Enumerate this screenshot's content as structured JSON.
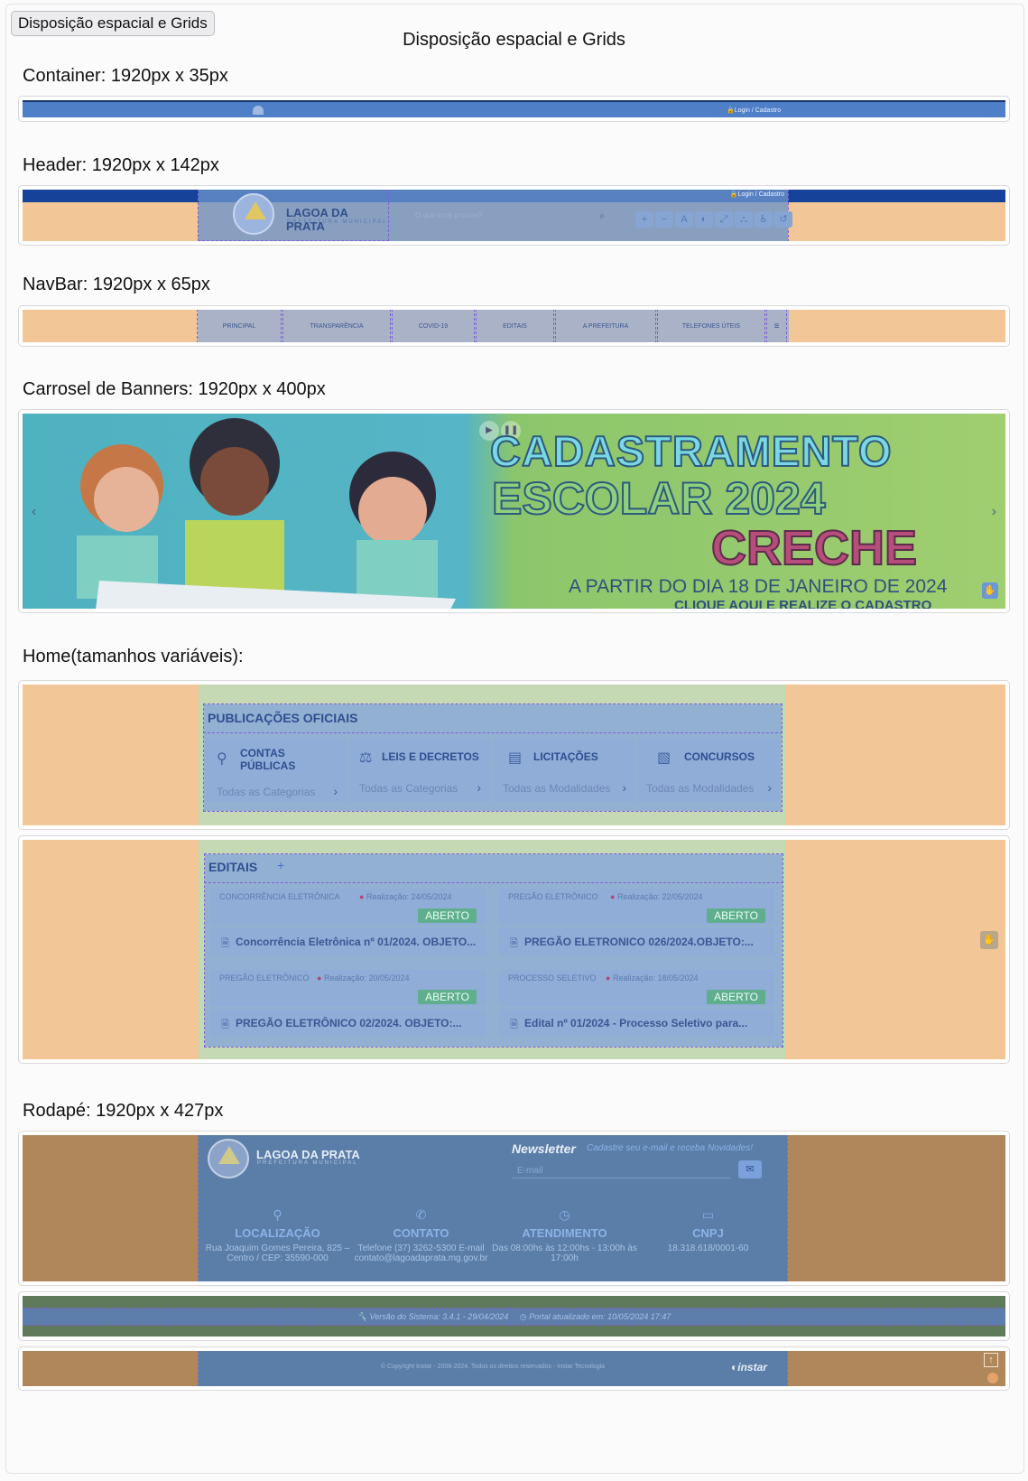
{
  "top_button": "Disposição espacial e Grids",
  "page_title": "Disposição espacial e Grids",
  "sections": {
    "container": "Container: 1920px x 35px",
    "header": "Header: 1920px x 142px",
    "navbar": "NavBar: 1920px x 65px",
    "carousel": "Carrosel de Banners: 1920px x 400px",
    "home": "Home(tamanhos variáveis):",
    "footer": "Rodapé: 1920px x 427px"
  },
  "container_bar": {
    "login": "Login",
    "sep": "/",
    "cadastro": "Cadastro"
  },
  "header": {
    "brand": "LAGOA DA PRATA",
    "brand_sub": "PREFEITURA MUNICIPAL",
    "search_placeholder": "O que você procura?",
    "login": "Login",
    "sep": "/",
    "cadastro": "Cadastro",
    "tools": [
      "+",
      "−",
      "A",
      "◐",
      "⤢",
      "⛬",
      "♿",
      "↺"
    ]
  },
  "navbar": {
    "items": [
      "PRINCIPAL",
      "TRANSPARÊNCIA",
      "COVID-19",
      "EDITAIS",
      "A PREFEITURA",
      "TELEFONES ÚTEIS"
    ],
    "menu_icon": "≡"
  },
  "banner": {
    "line1": "CADASTRAMENTO",
    "line2": "ESCOLAR 2024",
    "line3": "CRECHE",
    "line4": "A PARTIR DO DIA 18 DE JANEIRO DE 2024",
    "line5": "CLIQUE AQUI E REALIZE O CADASTRO",
    "colors": {
      "teal": "#4fb2bf",
      "green": "#8cc66c",
      "magenta": "#b64d7a"
    }
  },
  "publicacoes": {
    "title": "PUBLICAÇÕES OFICIAIS",
    "cards": [
      {
        "title": "CONTAS PÚBLICAS",
        "link": "Todas as Categorias"
      },
      {
        "title": "LEIS E DECRETOS",
        "link": "Todas as Categorias"
      },
      {
        "title": "LICITAÇÕES",
        "link": "Todas as Modalidades"
      },
      {
        "title": "CONCURSOS",
        "link": "Todas as Modalidades"
      }
    ]
  },
  "editais": {
    "title": "EDITAIS",
    "add": "+",
    "items": [
      {
        "type": "CONCORRÊNCIA ELETRÔNICA",
        "date": "Realização: 24/05/2024",
        "status": "ABERTO",
        "name": "Concorrência Eletrônica nº 01/2024. OBJETO..."
      },
      {
        "type": "PREGÃO ELETRÔNICO",
        "date": "Realização: 22/05/2024",
        "status": "ABERTO",
        "name": "PREGÃO ELETRONICO 026/2024.OBJETO:..."
      },
      {
        "type": "PREGÃO ELETRÔNICO",
        "date": "Realização: 20/05/2024",
        "status": "ABERTO",
        "name": "PREGÃO ELETRÔNICO 02/2024. OBJETO:..."
      },
      {
        "type": "PROCESSO SELETIVO",
        "date": "Realização: 18/05/2024",
        "status": "ABERTO",
        "name": "Edital nº 01/2024 - Processo Seletivo para..."
      }
    ]
  },
  "footer": {
    "brand": "LAGOA DA PRATA",
    "brand_sub": "PREFEITURA MUNICIPAL",
    "newsletter_title": "Newsletter",
    "newsletter_sub": "Cadastre seu e-mail e receba Novidades!",
    "email_placeholder": "E-mail",
    "cols": [
      {
        "title": "LOCALIZAÇÃO",
        "text": "Rua Joaquim Gomes Pereira, 825 – Centro / CEP: 35590-000"
      },
      {
        "title": "CONTATO",
        "text": "Telefone (37) 3262-5300 E-mail contato@lagoadaprata.mg.gov.br"
      },
      {
        "title": "ATENDIMENTO",
        "text": "Das 08:00hs às 12:00hs - 13:00h às 17:00h"
      },
      {
        "title": "CNPJ",
        "text": "18.318.618/0001-60"
      }
    ],
    "version": "Versão do Sistema: 3.4.1 - 29/04/2024",
    "updated": "Portal atualizado em: 10/05/2024 17:47",
    "copyright": "© Copyright Instar - 2006-2024. Todos os direitos reservados - Instar Tecnologia",
    "instar": "instar"
  }
}
